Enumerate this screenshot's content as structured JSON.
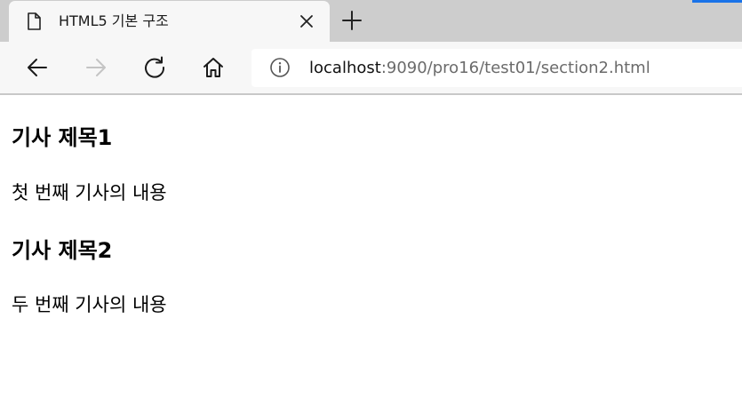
{
  "tab": {
    "title": "HTML5 기본 구조",
    "page_icon": "page-icon",
    "close_icon": "close-icon"
  },
  "toolbar": {
    "back_icon": "back-arrow-icon",
    "forward_icon": "forward-arrow-icon",
    "refresh_icon": "refresh-icon",
    "home_icon": "home-icon",
    "new_tab_icon": "plus-icon"
  },
  "address": {
    "info_icon": "info-icon",
    "host": "localhost",
    "path": ":9090/pro16/test01/section2.html"
  },
  "articles": [
    {
      "title": "기사 제목1",
      "body": "첫 번째 기사의 내용"
    },
    {
      "title": "기사 제목2",
      "body": "두 번째 기사의 내용"
    }
  ],
  "colors": {
    "tabstrip": "#cdcdcd",
    "toolbar": "#f7f7f7",
    "accent": "#1a73e8",
    "url_path": "#6b6b6b"
  }
}
